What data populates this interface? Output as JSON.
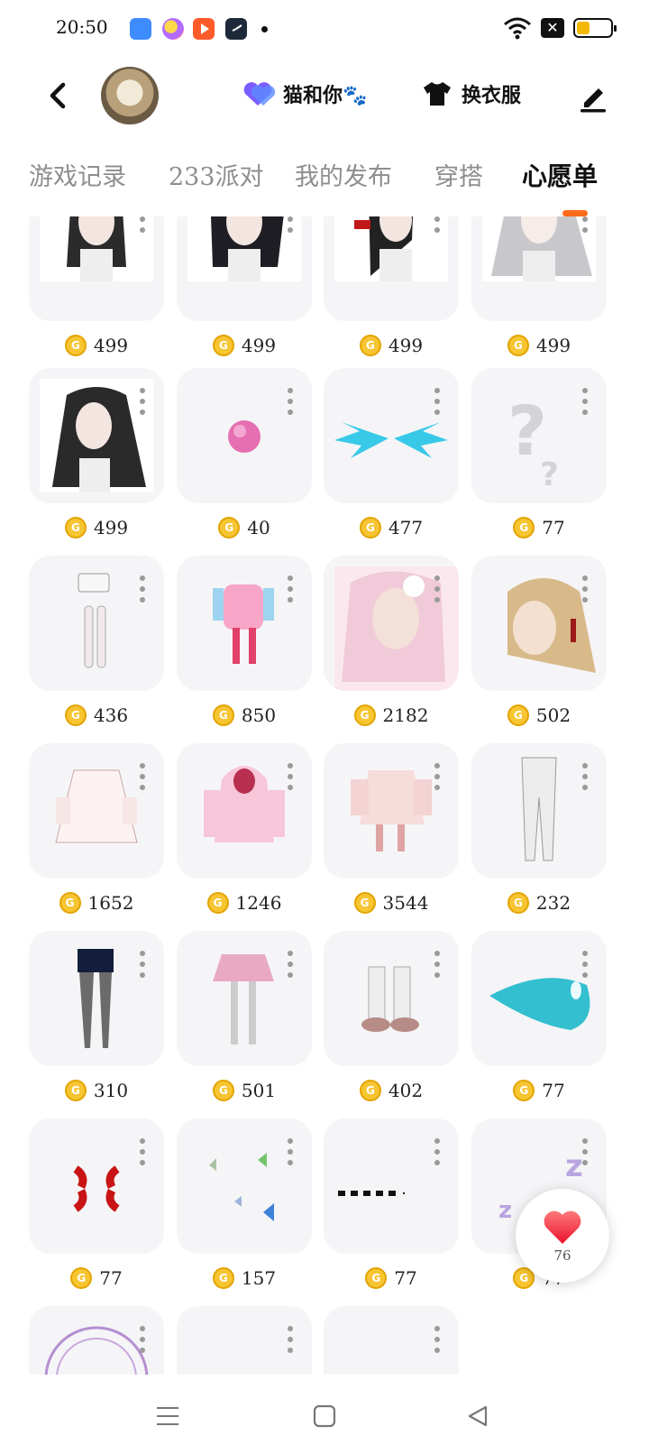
{
  "status_bar": {
    "time": "20:50",
    "battery_level": 0.4,
    "icons": [
      "app-blue-icon",
      "app-colorful-icon",
      "app-video-icon",
      "app-clock-icon",
      "notification-dot",
      "wifi-icon",
      "battery-saver-icon",
      "battery-icon"
    ]
  },
  "header": {
    "back_icon": "chevron-left-icon",
    "nickname": "猫和你🐾",
    "outfit_label": "换衣服",
    "edit_icon": "pen-icon",
    "accent_heart_color": "#7b5cff"
  },
  "tabs": [
    {
      "label": "游戏记录",
      "active": false
    },
    {
      "label": "233派对",
      "active": false
    },
    {
      "label": "我的发布",
      "active": false
    },
    {
      "label": "穿搭",
      "active": false
    },
    {
      "label": "心愿单",
      "active": true
    }
  ],
  "tab_indicator_color": "#ff6b1a",
  "wishlist": [
    {
      "item": "braided-hair",
      "price": "499"
    },
    {
      "item": "cat-ear-braids",
      "price": "499"
    },
    {
      "item": "red-bow-hair",
      "price": "499"
    },
    {
      "item": "silver-long-hair",
      "price": "499"
    },
    {
      "item": "long-black-hair",
      "price": "499"
    },
    {
      "item": "pink-ball",
      "price": "40"
    },
    {
      "item": "ice-wings",
      "price": "477"
    },
    {
      "item": "unknown-item",
      "price": "77"
    },
    {
      "item": "shorts-stockings",
      "price": "436"
    },
    {
      "item": "pink-idol-outfit",
      "price": "850"
    },
    {
      "item": "pink-flower-hair",
      "price": "2182"
    },
    {
      "item": "blonde-bun-hair",
      "price": "502"
    },
    {
      "item": "white-frill-dress",
      "price": "1652"
    },
    {
      "item": "pink-hoodie",
      "price": "1246"
    },
    {
      "item": "frilly-outfit",
      "price": "3544"
    },
    {
      "item": "white-tights",
      "price": "232"
    },
    {
      "item": "black-stockings",
      "price": "310"
    },
    {
      "item": "plaid-skirt-set",
      "price": "501"
    },
    {
      "item": "lace-boots",
      "price": "402"
    },
    {
      "item": "blue-drop-bubble",
      "price": "77"
    },
    {
      "item": "anger-mark",
      "price": "77"
    },
    {
      "item": "butterflies",
      "price": "157"
    },
    {
      "item": "dotted-line",
      "price": "77"
    },
    {
      "item": "sleep-zz",
      "price": "77"
    },
    {
      "item": "magic-circle",
      "price": ""
    },
    {
      "item": "item-26",
      "price": ""
    },
    {
      "item": "item-27",
      "price": ""
    }
  ],
  "like_fab": {
    "count": "76",
    "icon": "heart-icon"
  },
  "nav": {
    "menu_icon": "menu-icon",
    "home_icon": "home-icon",
    "back_icon": "back-triangle-icon"
  }
}
